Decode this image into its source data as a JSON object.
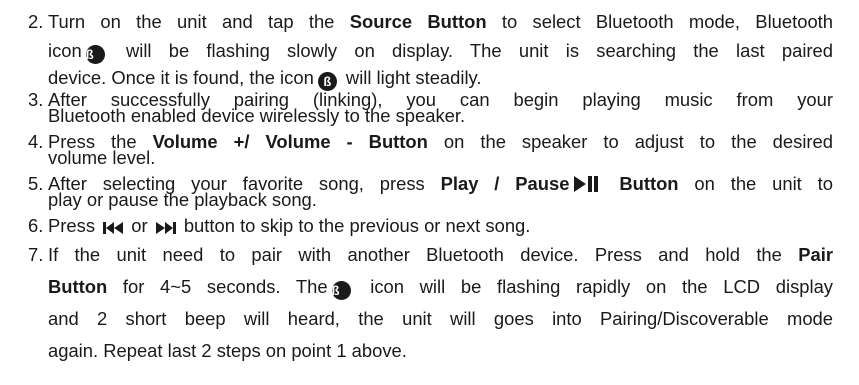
{
  "colors": {
    "text": "#1a1a1a",
    "background": "#ffffff"
  },
  "icons": [
    "bluetooth-icon",
    "play-pause-icon",
    "previous-track-icon",
    "next-track-icon"
  ],
  "steps": [
    {
      "num": "2.",
      "l1": "Turn on the unit and tap the ",
      "b1": "Source Button",
      "l1b": " to select Bluetooth mode, Bluetooth",
      "l2a": "icon",
      "l2b": " will be flashing slowly on display. The unit is searching the last paired",
      "l3a": "device. Once it is found, the icon",
      "l3b": " will light steadily."
    },
    {
      "num": "3.",
      "l1": "After successfully pairing (linking), you can begin playing music from your",
      "l2": "Bluetooth enabled device wirelessly to the speaker."
    },
    {
      "num": "4.",
      "l1a": "Press the ",
      "b1": "Volume +/ Volume - Button",
      "l1b": " on the speaker to adjust to the desired",
      "l2": "volume level."
    },
    {
      "num": "5.",
      "l1a": "After selecting your favorite song, press ",
      "b1": "Play / Pause",
      "b2": "Button",
      "l1b": " on the unit to",
      "l2": "play or pause the playback song."
    },
    {
      "num": "6.",
      "l1a": "Press",
      "l1m": " or ",
      "l1b": " button to skip to the previous or next song."
    },
    {
      "num": "7.",
      "l1a": "If the unit need to pair with another Bluetooth device. Press and hold the ",
      "b1": "Pair",
      "b2": "Button",
      "l2a": " for 4~5 seconds. The",
      "l2b": " icon will be flashing rapidly on the LCD display",
      "l3": "and 2 short beep will heard, the unit will goes into Pairing/Discoverable mode",
      "l4": "again. Repeat last 2 steps on point 1 above."
    }
  ]
}
